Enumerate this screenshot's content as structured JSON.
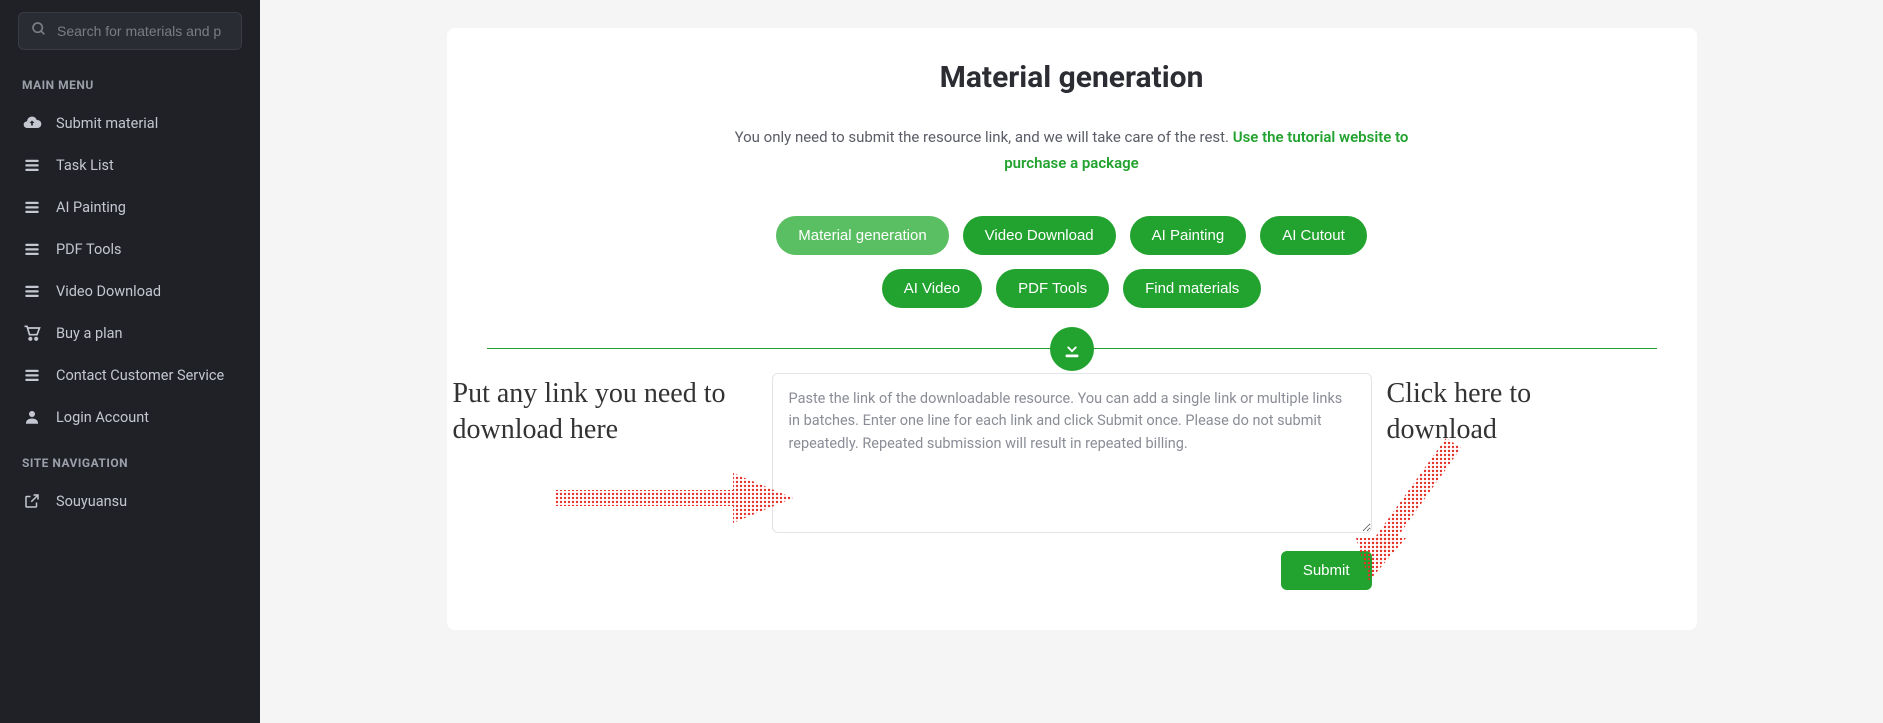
{
  "search": {
    "placeholder": "Search for materials and p"
  },
  "sidebar": {
    "header_main": "MAIN MENU",
    "header_site": "SITE NAVIGATION",
    "items": [
      {
        "label": "Submit material"
      },
      {
        "label": "Task List"
      },
      {
        "label": "AI Painting"
      },
      {
        "label": "PDF Tools"
      },
      {
        "label": "Video Download"
      },
      {
        "label": "Buy a plan"
      },
      {
        "label": "Contact Customer Service"
      },
      {
        "label": "Login Account"
      }
    ],
    "site_items": [
      {
        "label": "Souyuansu"
      }
    ]
  },
  "page": {
    "title": "Material generation",
    "subtext_plain": "You only need to submit the resource link, and we will take care of the rest. ",
    "subtext_link": "Use the tutorial website to purchase a package"
  },
  "pills": [
    {
      "label": "Material generation",
      "active": true
    },
    {
      "label": "Video Download",
      "active": false
    },
    {
      "label": "AI Painting",
      "active": false
    },
    {
      "label": "AI Cutout",
      "active": false
    },
    {
      "label": "AI Video",
      "active": false
    },
    {
      "label": "PDF Tools",
      "active": false
    },
    {
      "label": "Find materials",
      "active": false
    }
  ],
  "form": {
    "textarea_placeholder": "Paste the link of the downloadable resource. You can add a single link or multiple links in batches. Enter one line for each link and click Submit once. Please do not submit repeatedly. Repeated submission will result in repeated billing.",
    "submit_label": "Submit"
  },
  "annotations": {
    "left": "Put any link you need to download here",
    "right": "Click here to download"
  },
  "colors": {
    "accent": "#22a22e"
  }
}
